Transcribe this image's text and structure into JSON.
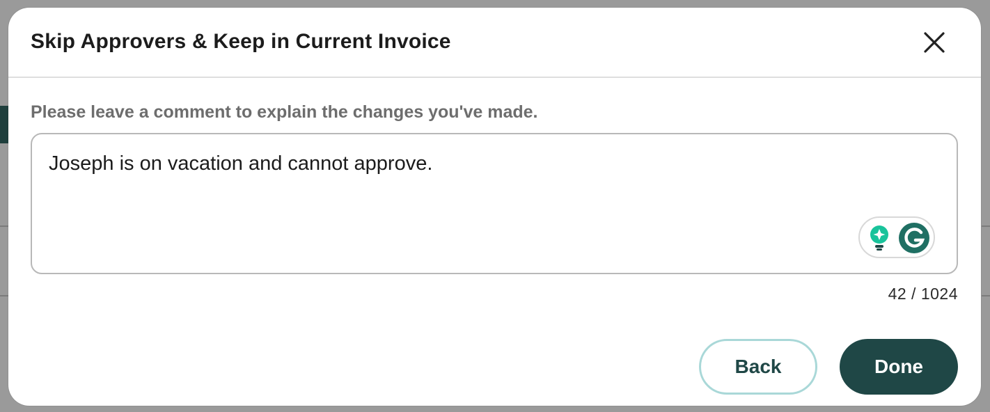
{
  "modal": {
    "title": "Skip Approvers & Keep in Current Invoice",
    "prompt": "Please leave a comment to explain the changes you've made.",
    "comment_value": "Joseph is on vacation and cannot approve.",
    "char_count": "42 / 1024",
    "back_label": "Back",
    "done_label": "Done"
  },
  "colors": {
    "primary": "#1f4746",
    "back_border": "#a9d8d8",
    "grammarly_green": "#15c39a"
  },
  "icons": {
    "close": "close-icon",
    "grammarly_suggestion": "lightbulb-icon",
    "grammarly_logo": "grammarly-icon"
  }
}
